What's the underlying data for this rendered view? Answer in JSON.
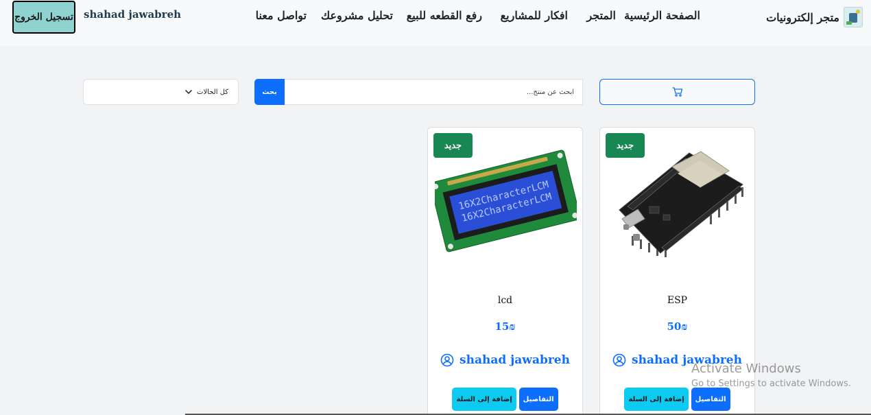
{
  "navbar": {
    "brand": "متجر إلكترونيات",
    "links": [
      {
        "label": "الصفحة الرئيسية"
      },
      {
        "label": "المتجر"
      },
      {
        "label": "افكار للمشاريع"
      },
      {
        "label": "رفع القطعه للبيع"
      },
      {
        "label": "تحليل مشروعك"
      },
      {
        "label": "تواصل معنا"
      }
    ],
    "username": "shahad jawabreh",
    "logout_label": "تسجيل الخروج"
  },
  "toolbar": {
    "cart_icon": "cart-icon",
    "search_placeholder": "ابحث عن منتج...",
    "search_button": "بحث",
    "status_select_value": "كل الحالات"
  },
  "products": [
    {
      "name": "ESP",
      "price": "50₪",
      "badge": "جديد",
      "seller": "shahad jawabreh",
      "add_to_cart": "إضافة إلى السلة",
      "details": "التفاصيل",
      "image": "esp32-board"
    },
    {
      "name": "lcd",
      "price": "15₪",
      "badge": "جديد",
      "seller": "shahad jawabreh",
      "add_to_cart": "إضافة إلى السلة",
      "details": "التفاصيل",
      "image": "lcd-16x2-module",
      "lcd_text": [
        "16X2CharacterLCM",
        "16X2CharacterLCM"
      ]
    }
  ],
  "watermark": {
    "line1": "Activate Windows",
    "line2": "Go to Settings to activate Windows."
  },
  "colors": {
    "primary": "#0d6efd",
    "info": "#0dcaf0",
    "success_badge": "#198754",
    "logout_bg": "#8fd3d1",
    "navbar_bg": "#f8f9fa",
    "page_bg": "#f1f3f5"
  }
}
